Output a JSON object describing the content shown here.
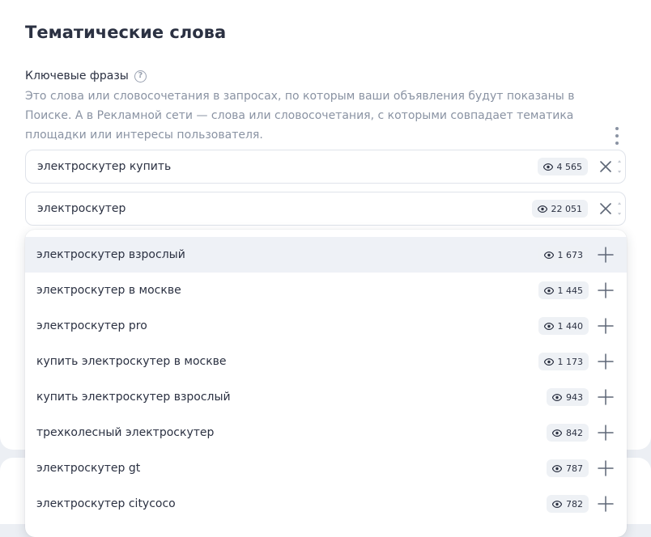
{
  "section": {
    "title": "Тематические слова",
    "keyphrases_label": "Ключевые фразы",
    "help_symbol": "?",
    "description": "Это слова или словосочетания в запросах, по которым ваши объявления будут показаны в Поиске. А в Рекламной сети — слова или словосочетания, с которыми совпадает тематика площадки или интересы пользователя."
  },
  "phrases": [
    {
      "text": "электроскутер купить",
      "impressions": "4 565"
    },
    {
      "text": "электроскутер",
      "impressions": "22 051"
    }
  ],
  "suggestions": [
    {
      "text": "электроскутер взрослый",
      "impressions": "1 673"
    },
    {
      "text": "электроскутер в москве",
      "impressions": "1 445"
    },
    {
      "text": "электроскутер pro",
      "impressions": "1 440"
    },
    {
      "text": "купить электроскутер в москве",
      "impressions": "1 173"
    },
    {
      "text": "купить электроскутер взрослый",
      "impressions": "943"
    },
    {
      "text": "трехколесный электроскутер",
      "impressions": "842"
    },
    {
      "text": "электроскутер gt",
      "impressions": "787"
    },
    {
      "text": "электроскутер citycoco",
      "impressions": "782"
    }
  ],
  "icons": {
    "help": "question-circle-icon",
    "more": "more-vertical-icon",
    "impressions": "eye-icon",
    "remove": "close-icon",
    "add": "plus-icon",
    "reorder": "stepper-icon"
  },
  "colors": {
    "text_primary": "#2b3142",
    "text_secondary": "#8a93a3",
    "badge_bg": "#eef1f5",
    "hover_bg": "#eef1f6",
    "page_bg": "#eceff4"
  }
}
